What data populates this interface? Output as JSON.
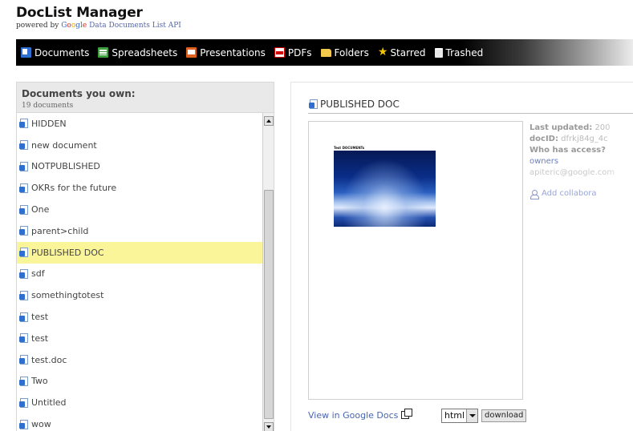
{
  "app": {
    "title": "DocList Manager",
    "powered_prefix": "powered by",
    "powered_google": [
      "G",
      "o",
      "o",
      "g",
      "l",
      "e"
    ],
    "powered_suffix": "Data Documents List API"
  },
  "nav": {
    "items": [
      {
        "label": "Documents",
        "icon": "documents-icon"
      },
      {
        "label": "Spreadsheets",
        "icon": "spreadsheets-icon"
      },
      {
        "label": "Presentations",
        "icon": "presentations-icon"
      },
      {
        "label": "PDFs",
        "icon": "pdf-icon"
      },
      {
        "label": "Folders",
        "icon": "folder-icon"
      },
      {
        "label": "Starred",
        "icon": "star-icon"
      },
      {
        "label": "Trashed",
        "icon": "trash-icon"
      }
    ]
  },
  "doc_list": {
    "title": "Documents you own:",
    "count": "19 documents",
    "items": [
      {
        "label": "HIDDEN"
      },
      {
        "label": "new document"
      },
      {
        "label": "NOTPUBLISHED"
      },
      {
        "label": "OKRs for the future"
      },
      {
        "label": "One"
      },
      {
        "label": "parent>child"
      },
      {
        "label": "PUBLISHED DOC",
        "selected": true
      },
      {
        "label": "sdf"
      },
      {
        "label": "somethingtotest"
      },
      {
        "label": "test"
      },
      {
        "label": "test"
      },
      {
        "label": "test.doc"
      },
      {
        "label": "Two"
      },
      {
        "label": "Untitled"
      },
      {
        "label": "wow"
      }
    ]
  },
  "detail": {
    "title": "PUBLISHED DOC",
    "preview_heading": "Test DOCUMENTs",
    "last_updated_label": "Last updated:",
    "last_updated_value": "200",
    "docid_label": "docID:",
    "docid_value": "dfrkj84g_4c",
    "access_label": "Who has access?",
    "owners_label": "owners",
    "owner_email": "apiteric@google.com",
    "add_collaborator": "Add collabora",
    "view_link": "View in Google Docs",
    "format_value": "html",
    "download_label": "download"
  },
  "colors": {
    "nav_bg": "#000000",
    "selected_row": "#fbf59a",
    "link": "#4a65b0"
  }
}
